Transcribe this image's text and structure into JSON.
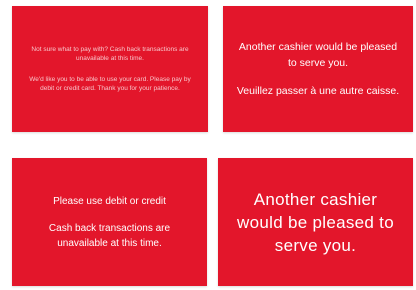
{
  "cards": [
    {
      "lines": [
        "Not sure what to pay with? Cash back transactions are unavailable at this time.",
        "We'd like you to be able to use your card. Please pay by debit or credit card. Thank you for your patience."
      ]
    },
    {
      "lines": [
        "Another cashier would be pleased to serve you.",
        "Veuillez passer à une autre caisse."
      ]
    },
    {
      "lines": [
        "Please use debit or credit",
        "Cash back transactions are unavailable at this time."
      ]
    },
    {
      "lines": [
        "Another cashier would be pleased to serve you."
      ]
    }
  ],
  "colors": {
    "sign_red": "#e3162b",
    "text": "#ffffff",
    "watermark": "#e3162b"
  }
}
